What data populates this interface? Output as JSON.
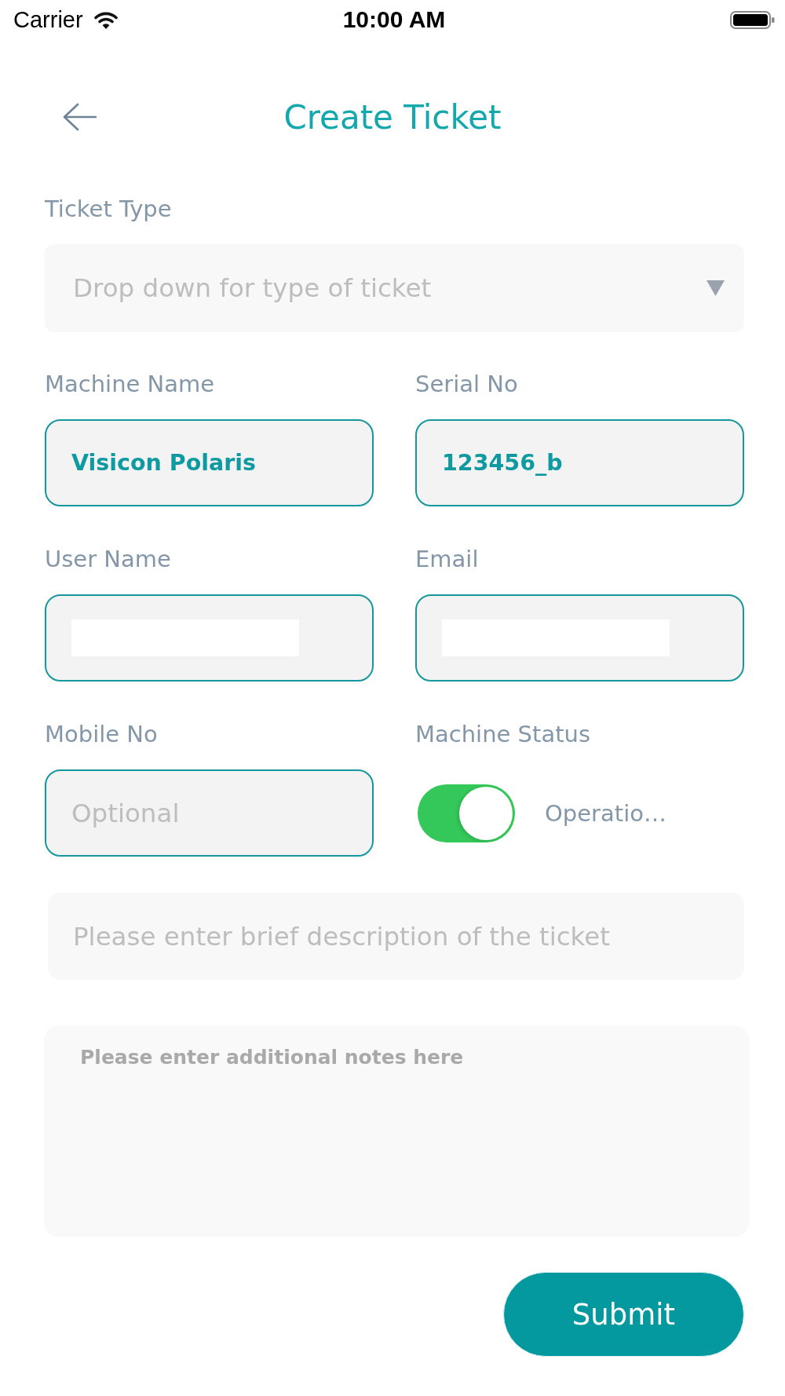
{
  "status_bar": {
    "carrier": "Carrier",
    "time": "10:00 AM"
  },
  "header": {
    "title": "Create Ticket"
  },
  "form": {
    "ticket_type": {
      "label": "Ticket Type",
      "placeholder": "Drop down for type of ticket"
    },
    "fields": [
      {
        "label": "Machine Name",
        "value": "Visicon Polaris",
        "redacted": false
      },
      {
        "label": "Serial No",
        "value": "123456_b",
        "redacted": false
      },
      {
        "label": "User Name",
        "redacted": true
      },
      {
        "label": "Email",
        "redacted": true
      },
      {
        "label": "Mobile No",
        "placeholder": "Optional",
        "redacted": false
      }
    ],
    "machine_status": {
      "label": "Machine Status",
      "on": true,
      "status": "Operatio…"
    },
    "description": {
      "placeholder": "Please enter brief description of the ticket"
    },
    "notes": {
      "placeholder": "Please enter additional notes here"
    },
    "submit": "Submit"
  }
}
